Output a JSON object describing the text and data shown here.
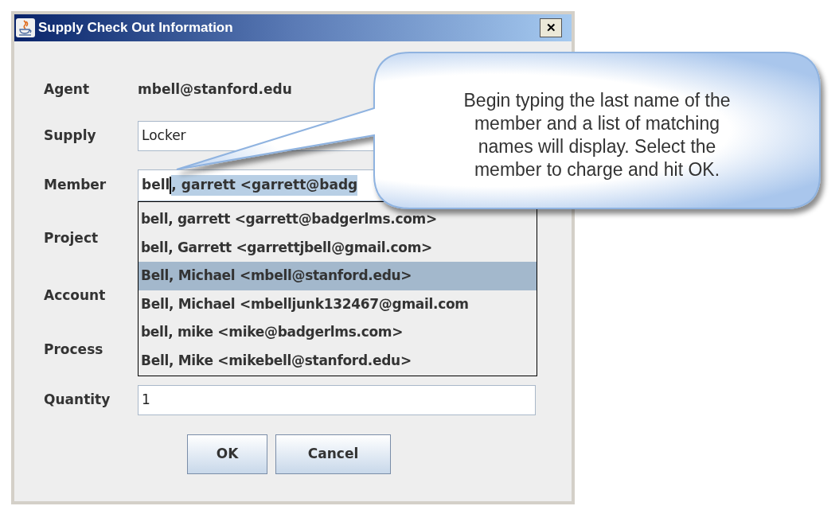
{
  "window": {
    "title": "Supply Check Out Information",
    "close_label": "✕"
  },
  "fields": [
    {
      "kind": "text",
      "label": "Agent",
      "value": "mbell@stanford.edu"
    },
    {
      "kind": "input",
      "label": "Supply",
      "value": "Locker"
    },
    {
      "kind": "autocomplete",
      "label": "Member",
      "typed": "bell",
      "completion": ", garrett <garrett@badg"
    },
    {
      "kind": "hidden",
      "label": "Project"
    },
    {
      "kind": "hidden",
      "label": "Account"
    },
    {
      "kind": "hidden",
      "label": "Process"
    },
    {
      "kind": "input",
      "label": "Quantity",
      "value": "1"
    }
  ],
  "suggestions": [
    {
      "text": "bell, garrett <garrett@badgerlms.com>",
      "selected": false
    },
    {
      "text": "bell, Garrett <garrettjbell@gmail.com>",
      "selected": false
    },
    {
      "text": "Bell, Michael <mbell@stanford.edu>",
      "selected": true
    },
    {
      "text": "Bell, Michael <mbelljunk132467@gmail.com",
      "selected": false
    },
    {
      "text": "bell, mike <mike@badgerlms.com>",
      "selected": false
    },
    {
      "text": "Bell, Mike <mikebell@stanford.edu>",
      "selected": false
    }
  ],
  "buttons": [
    "OK",
    "Cancel"
  ],
  "callout": {
    "text": "Begin typing the last name of the member and a list of matching names will display. Select the member to charge and hit OK."
  }
}
